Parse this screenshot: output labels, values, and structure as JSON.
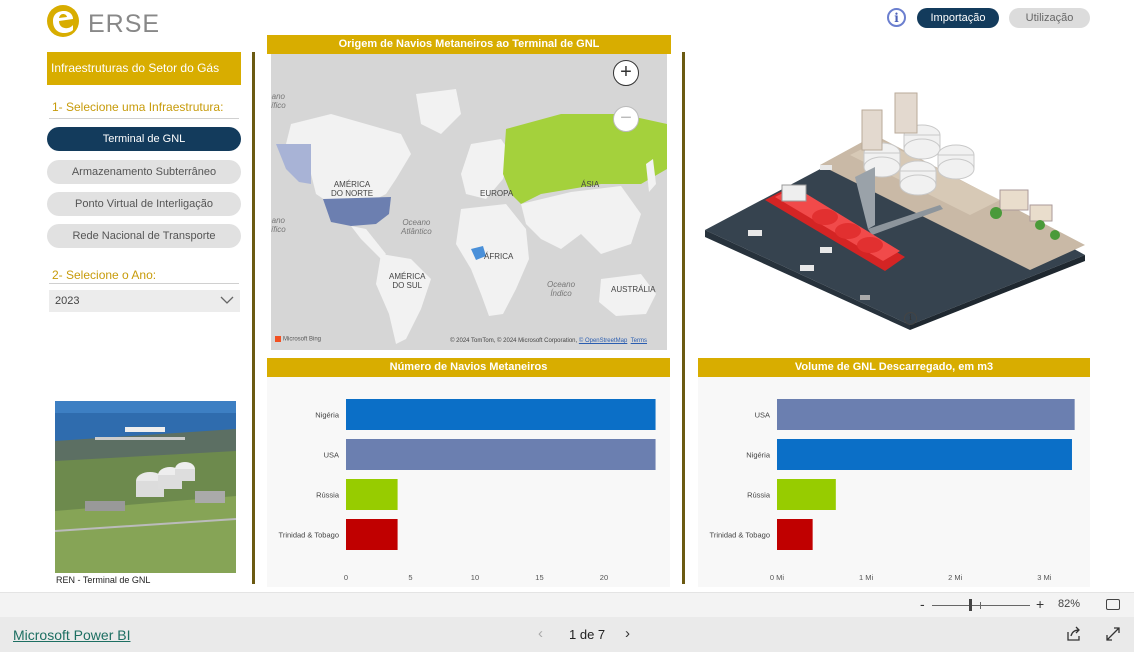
{
  "header": {
    "logo_text": "ERSE",
    "info_label": "i",
    "tabs": [
      {
        "label": "Importação",
        "active": true
      },
      {
        "label": "Utilização",
        "active": false
      }
    ]
  },
  "sidebar": {
    "title": "Infraestruturas do Setor do Gás",
    "infra_label": "1- Selecione uma Infraestrutura:",
    "infra_options": [
      {
        "label": "Terminal de GNL",
        "active": true
      },
      {
        "label": "Armazenamento Subterrâneo",
        "active": false
      },
      {
        "label": "Ponto Virtual de Interligação",
        "active": false
      },
      {
        "label": "Rede Nacional de Transporte",
        "active": false
      }
    ],
    "year_label": "2- Selecione o Ano:",
    "year_value": "2023",
    "photo_caption": "REN - Terminal de GNL"
  },
  "map": {
    "title": "Origem de Navios Metaneiros ao Terminal de GNL",
    "zoom_in": "+",
    "zoom_out": "−",
    "labels": {
      "north_america": "AMÉRICA\nDO NORTE",
      "south_america": "AMÉRICA\nDO SUL",
      "europe": "EUROPA",
      "asia": "ÁSIA",
      "africa": "ÁFRICA",
      "australia": "AUSTRÁLIA",
      "atlantic": "Oceano\nAtlântico",
      "indian": "Oceano\nÍndico",
      "pacific_top": "ano\nífico",
      "pacific_mid": "ano\nífico"
    },
    "bing": "Microsoft Bing",
    "copyright": "© 2024 TomTom, © 2024 Microsoft Corporation, ",
    "osm": "© OpenStreetMap",
    "terms": "Terms",
    "highlight_colors": {
      "usa": "#6c7fb0",
      "nigeria": "#4a90d9",
      "russia": "#a4d13c"
    }
  },
  "chart_data": [
    {
      "type": "bar",
      "title": "Número de Navios Metaneiros",
      "categories": [
        "Nigéria",
        "USA",
        "Rússia",
        "Trinidad & Tobago"
      ],
      "values": [
        24,
        24,
        4,
        4
      ],
      "colors": [
        "#0b6fc7",
        "#6b7fb0",
        "#97cc00",
        "#c00000"
      ],
      "xticks": [
        "0",
        "5",
        "10",
        "15",
        "20"
      ],
      "xlim": [
        0,
        24.5
      ],
      "orientation": "horizontal"
    },
    {
      "type": "bar",
      "title": "Volume de GNL Descarregado, em m3",
      "categories": [
        "USA",
        "Nigéria",
        "Rússia",
        "Trinidad & Tobago"
      ],
      "values": [
        3340000,
        3310000,
        660000,
        400000
      ],
      "colors": [
        "#6b7fb0",
        "#0b6fc7",
        "#97cc00",
        "#c00000"
      ],
      "xticks": [
        "0 Mi",
        "1 Mi",
        "2 Mi",
        "3 Mi"
      ],
      "xtick_values": [
        0,
        1000000,
        2000000,
        3000000
      ],
      "xlim": [
        0,
        3400000
      ],
      "orientation": "horizontal"
    }
  ],
  "footer": {
    "zoom_pct": "82%",
    "powerbi_link": "Microsoft Power BI",
    "page_indicator": "1 de 7"
  }
}
